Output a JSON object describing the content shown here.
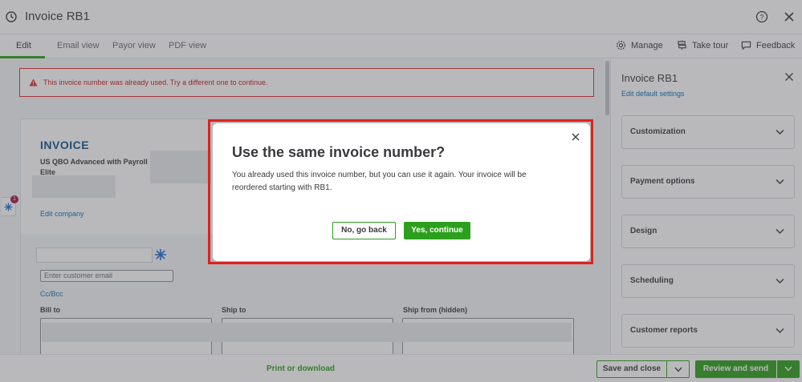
{
  "window": {
    "title": "Invoice RB1"
  },
  "tabs": [
    {
      "label": "Edit"
    },
    {
      "label": "Email view"
    },
    {
      "label": "Payor view"
    },
    {
      "label": "PDF view"
    }
  ],
  "toolbar": {
    "manage": "Manage",
    "take_tour": "Take tour",
    "feedback": "Feedback"
  },
  "error": {
    "message": "This invoice number was already used. Try a different one to continue."
  },
  "invoice": {
    "heading": "INVOICE",
    "company": "US QBO Advanced with Payroll Elite",
    "edit_company": "Edit company",
    "email_placeholder": "Enter customer email",
    "cc_bcc": "Cc/Bcc",
    "bill_to": "Bill to",
    "ship_to": "Ship to",
    "ship_from": "Ship from (hidden)"
  },
  "side_badge": {
    "count": "1"
  },
  "panel": {
    "title": "Invoice RB1",
    "edit_defaults": "Edit default settings",
    "sections": [
      {
        "label": "Customization"
      },
      {
        "label": "Payment options"
      },
      {
        "label": "Design"
      },
      {
        "label": "Scheduling"
      },
      {
        "label": "Customer reports"
      }
    ]
  },
  "footer": {
    "print": "Print or download",
    "save": "Save and close",
    "review": "Review and send"
  },
  "modal": {
    "title": "Use the same invoice number?",
    "body": "You already used this invoice number, but you can use it again. Your invoice will be reordered starting with RB1.",
    "back": "No, go back",
    "confirm": "Yes, continue"
  },
  "colors": {
    "accent": "#2ca01c",
    "error": "#c41c1c",
    "link": "#0d6fb8",
    "highlight": "#e0211b"
  }
}
